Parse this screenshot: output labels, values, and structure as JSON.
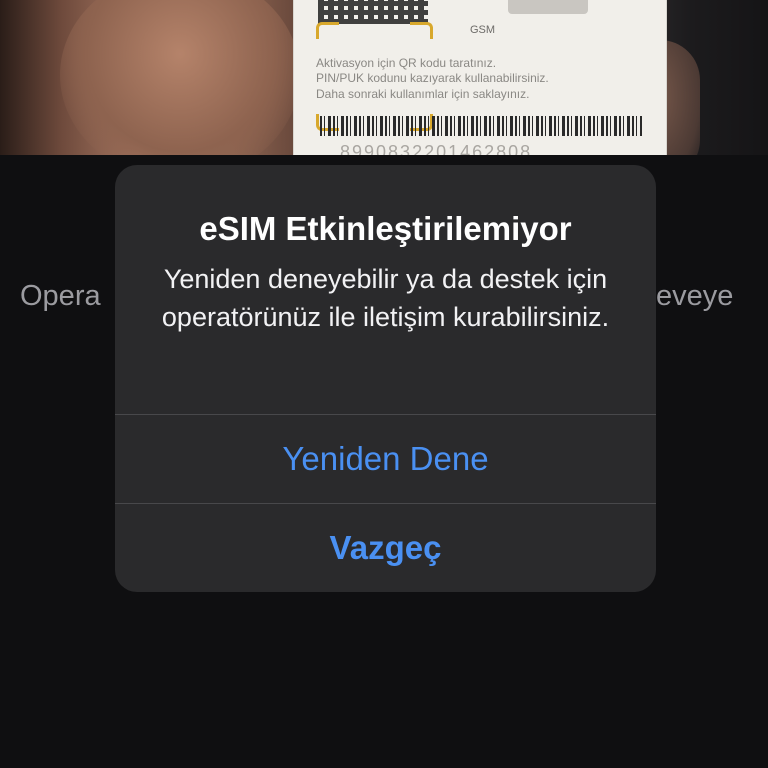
{
  "camera": {
    "card_label": "GSM",
    "card_lines": [
      "Aktivasyon için QR kodu taratınız.",
      "PIN/PUK kodunu kazıyarak kullanabilirsiniz.",
      "Daha sonraki kullanımlar için saklayınız."
    ],
    "card_serial": "8990832201462808..."
  },
  "background": {
    "left_text": "Opera",
    "right_text": "eveye"
  },
  "alert": {
    "title": "eSIM Etkinleştirilemiyor",
    "message": "Yeniden deneyebilir ya da destek için operatörünüz ile iletişim kurabilirsiniz.",
    "retry_label": "Yeniden Dene",
    "cancel_label": "Vazgeç"
  },
  "colors": {
    "accent": "#4a90f2",
    "alert_bg": "#2a2a2c",
    "screen_bg": "#0f0f11"
  }
}
